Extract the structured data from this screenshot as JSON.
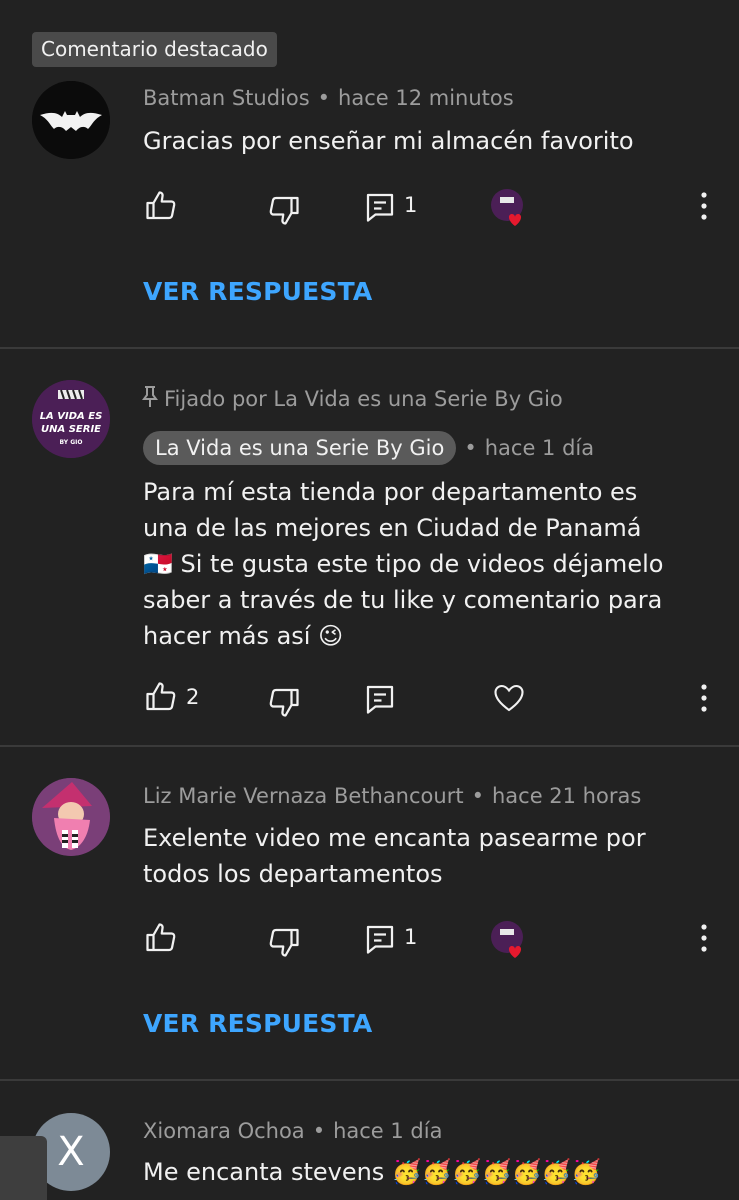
{
  "featured_badge": "Comentario destacado",
  "comments": [
    {
      "author": "Batman Studios",
      "time": "hace 12 minutos",
      "text": "Gracias por enseñar mi almacén favorito",
      "reply_count": "1",
      "view_replies": "VER RESPUESTA"
    },
    {
      "pinned_label": "Fijado por La Vida es una Serie By Gio",
      "author": "La Vida es una Serie By Gio",
      "time": "hace 1 día",
      "text_lines": [
        "Para mí esta tienda por departamento es",
        "una de las mejores en Ciudad de Panamá",
        "🇵🇦  Si te gusta este tipo de videos déjamelo",
        "saber a través de tu like y comentario para",
        "hacer más así 😉"
      ],
      "like_count": "2",
      "avatar_text_1": "LA VIDA ES",
      "avatar_text_2": "UNA SERIE",
      "avatar_text_3": "BY GIO"
    },
    {
      "author": "Liz Marie Vernaza Bethancourt",
      "time": "hace 21 horas",
      "text_lines": [
        "Exelente video me encanta pasearme por",
        "todos los departamentos"
      ],
      "reply_count": "1",
      "view_replies": "VER RESPUESTA"
    },
    {
      "author": "Xiomara Ochoa",
      "time": "hace 1 día",
      "text": "Me encanta stevens 🥳🥳🥳🥳🥳🥳🥳",
      "avatar_letter": "X"
    }
  ],
  "colors": {
    "background": "#222222",
    "link": "#3ea6ff",
    "meta": "#9c9c9c",
    "heart": "#e6192e",
    "channel_purple": "#4b1f56"
  }
}
